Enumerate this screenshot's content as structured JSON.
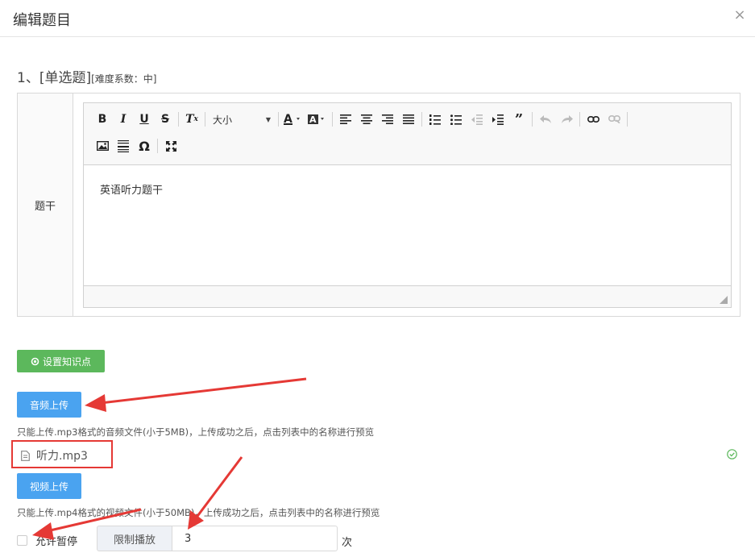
{
  "dialog": {
    "title": "编辑题目",
    "close_symbol": "×"
  },
  "question": {
    "number": "1、",
    "type": "[单选题]",
    "difficulty": "[难度系数：中]"
  },
  "stem": {
    "label": "题干",
    "content": "英语听力题干",
    "toolbar": {
      "font_size_select": "大小",
      "row1": [
        {
          "name": "bold-icon",
          "glyph": "B"
        },
        {
          "name": "italic-icon",
          "glyph": "I"
        },
        {
          "name": "underline-icon",
          "glyph": "U"
        },
        {
          "name": "strikethrough-icon",
          "glyph": "S"
        },
        {
          "name": "clear-format-icon",
          "glyph": "Tx"
        }
      ]
    }
  },
  "actions": {
    "knowledge_button": "设置知识点",
    "audio_upload_button": "音频上传",
    "video_upload_button": "视频上传"
  },
  "audio": {
    "hint": "只能上传.mp3格式的音频文件(小于5MB)，上传成功之后，点击列表中的名称进行预览",
    "file_name": "听力.mp3",
    "status": "success"
  },
  "video": {
    "hint": "只能上传.mp4格式的视频文件(小于50MB)，上传成功之后，点击列表中的名称进行预览"
  },
  "playback": {
    "allow_pause_label": "允许暂停",
    "allow_pause_checked": false,
    "limit_label": "限制播放",
    "limit_value": "3",
    "limit_unit": "次"
  },
  "colors": {
    "primary": "#4aa3f0",
    "success": "#5cb85c",
    "annotation": "#e53935"
  }
}
